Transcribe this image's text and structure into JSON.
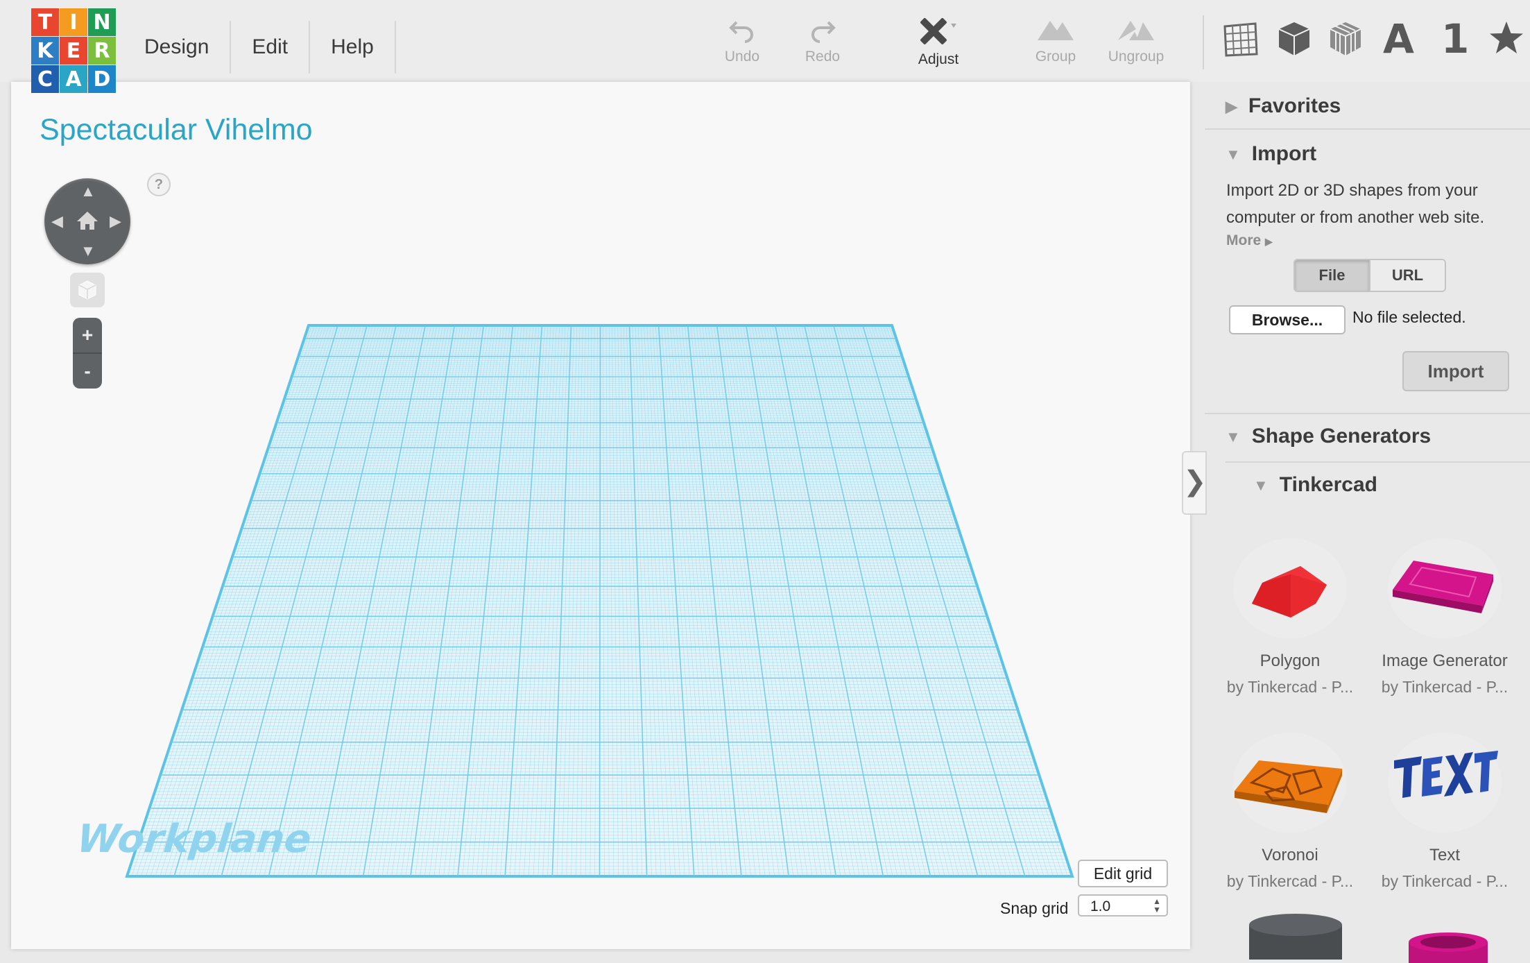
{
  "logo": {
    "letters": [
      "T",
      "I",
      "N",
      "K",
      "E",
      "R",
      "C",
      "A",
      "D"
    ],
    "colors": [
      "#e8462e",
      "#f39c1f",
      "#1f9d55",
      "#2d7ec4",
      "#e8462e",
      "#7cbf3c",
      "#1f5fae",
      "#2aa5c6",
      "#1d86c8"
    ]
  },
  "menu": [
    "Design",
    "Edit",
    "Help"
  ],
  "toolbar": {
    "undo": "Undo",
    "redo": "Redo",
    "adjust": "Adjust",
    "group": "Group",
    "ungroup": "Ungroup"
  },
  "view_icons": [
    "grid-icon",
    "box-icon",
    "wire-box-icon",
    "letter-a-icon",
    "number-one-icon",
    "star-icon"
  ],
  "view_text": {
    "letter": "A",
    "number": "1"
  },
  "workspace": {
    "title": "Spectacular Vihelmo",
    "help": "?",
    "workplane_label": "Workplane",
    "zoom_in": "+",
    "zoom_out": "-",
    "edit_grid": "Edit grid",
    "snap_label": "Snap grid",
    "snap_value": "1.0"
  },
  "panel": {
    "favorites": "Favorites",
    "import_title": "Import",
    "import_desc": "Import 2D or 3D shapes from your computer or from another web site.",
    "more": "More",
    "file_tab": "File",
    "url_tab": "URL",
    "browse": "Browse...",
    "no_file": "No file selected.",
    "import_button": "Import",
    "shape_generators": "Shape Generators",
    "tinkercad_section": "Tinkercad",
    "shapes": [
      {
        "name": "Polygon",
        "by": "by Tinkercad - P..."
      },
      {
        "name": "Image Generator",
        "by": "by Tinkercad - P..."
      },
      {
        "name": "Voronoi",
        "by": "by Tinkercad - P..."
      },
      {
        "name": "Text",
        "by": "by Tinkercad - P..."
      }
    ]
  },
  "colors": {
    "accent": "#2aa5c6",
    "grid": "#5cc3e6",
    "polygon": "#e8262b",
    "image_gen": "#d4148a",
    "voronoi": "#ec7a10",
    "text_shape": "#1e3f9a"
  }
}
